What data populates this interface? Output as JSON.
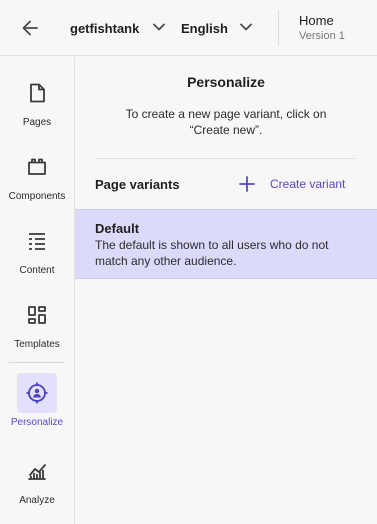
{
  "topbar": {
    "back_icon": "arrow-left-icon",
    "site": "getfishtank",
    "language": "English",
    "page_name": "Home",
    "page_version": "Version 1"
  },
  "rail": {
    "items": [
      {
        "label": "Pages",
        "icon": "page-icon"
      },
      {
        "label": "Components",
        "icon": "components-icon"
      },
      {
        "label": "Content",
        "icon": "content-list-icon"
      },
      {
        "label": "Templates",
        "icon": "templates-icon"
      },
      {
        "label": "Personalize",
        "icon": "target-person-icon",
        "active": true
      },
      {
        "label": "Analyze",
        "icon": "analytics-icon"
      }
    ]
  },
  "panel": {
    "title": "Personalize",
    "hint": "To create a new page variant, click on “Create new”.",
    "variants_heading": "Page variants",
    "create_label": "Create variant",
    "variants": [
      {
        "name": "Default",
        "description": "The default is shown to all users who do not match any other audience."
      }
    ]
  },
  "colors": {
    "accent": "#5548d9",
    "selected_bg": "#dcdafa",
    "active_icon_bg": "#e3e0fb",
    "surface": "#f7f7f7"
  }
}
